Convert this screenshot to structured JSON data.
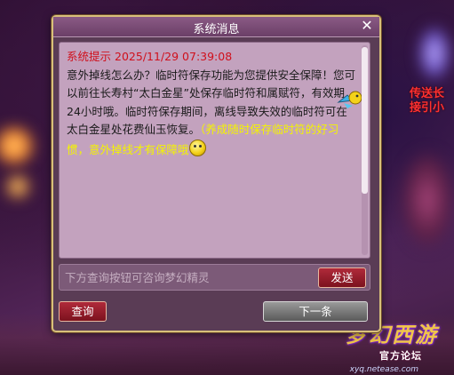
{
  "dialog": {
    "title": "系统消息",
    "close_symbol": "✕",
    "message": {
      "header_label": "系统提示",
      "timestamp": "2025/11/29 07:39:08",
      "body": "意外掉线怎么办？临时符保存功能为您提供安全保障！您可以前往长寿村“太白金星”处保存临时符和属赋符，有效期24小时哦。临时符保存期间，离线导致失效的临时符可在太白金星处花费仙玉恢复。",
      "tip": "（养成随时保存临时符的好习惯，意外掉线才有保障哦"
    },
    "input": {
      "placeholder": "下方查询按钮可咨询梦幻精灵",
      "value": ""
    },
    "send_label": "发送",
    "query_label": "查询",
    "next_label": "下一条"
  },
  "background": {
    "side_text": "传送长接引小",
    "logo_text": "梦幻西游",
    "logo_sub": "官方论坛",
    "url_text": "xyq.netease.com"
  },
  "colors": {
    "header_red": "#d0101c",
    "tip_yellow": "#f4f400",
    "border_gold": "#d8c07a",
    "button_red": "#b02a3a"
  },
  "icons": [
    "close-icon",
    "bird-emoji-icon",
    "smile-emoji-icon"
  ]
}
